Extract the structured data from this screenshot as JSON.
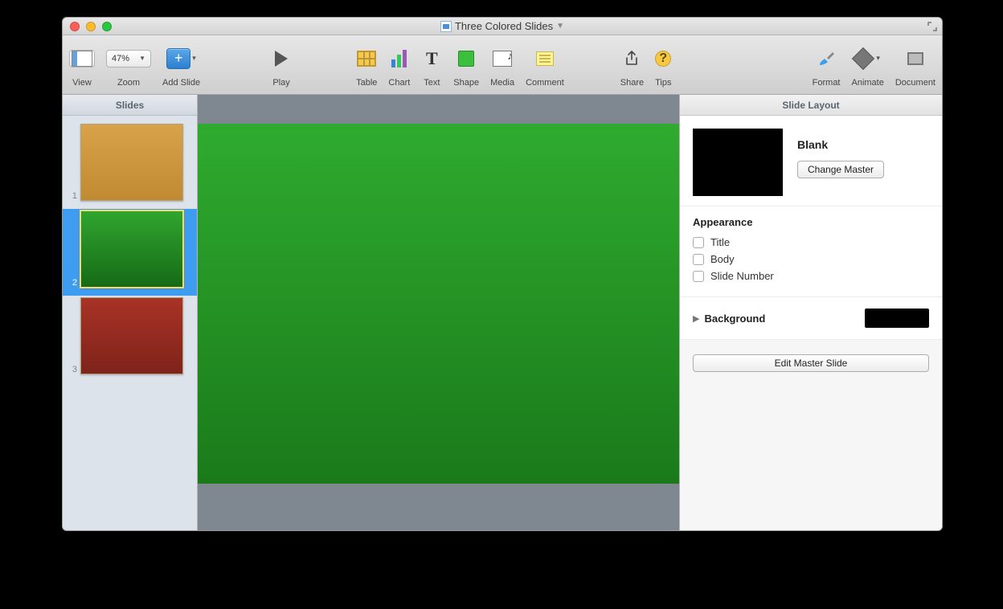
{
  "window": {
    "title": "Three Colored Slides"
  },
  "toolbar": {
    "view": "View",
    "zoom_label": "Zoom",
    "zoom_value": "47%",
    "add_slide": "Add Slide",
    "play": "Play",
    "table": "Table",
    "chart": "Chart",
    "text": "Text",
    "shape": "Shape",
    "media": "Media",
    "comment": "Comment",
    "share": "Share",
    "tips": "Tips",
    "format": "Format",
    "animate": "Animate",
    "document": "Document"
  },
  "sidebar": {
    "header": "Slides",
    "slides": [
      {
        "num": "1",
        "bg_start": "#d7a24a",
        "bg_end": "#c08a33"
      },
      {
        "num": "2",
        "bg_start": "#2fa52f",
        "bg_end": "#166b16"
      },
      {
        "num": "3",
        "bg_start": "#a93226",
        "bg_end": "#7e231b"
      }
    ],
    "selected_index": 1
  },
  "canvas": {
    "bg_start": "#2fab2f",
    "bg_end": "#1a7a1a"
  },
  "inspector": {
    "header": "Slide Layout",
    "master_name": "Blank",
    "change_master": "Change Master",
    "appearance_label": "Appearance",
    "checks": {
      "title": "Title",
      "body": "Body",
      "slide_number": "Slide Number"
    },
    "background_label": "Background",
    "background_color": "#000000",
    "edit_master": "Edit Master Slide"
  }
}
